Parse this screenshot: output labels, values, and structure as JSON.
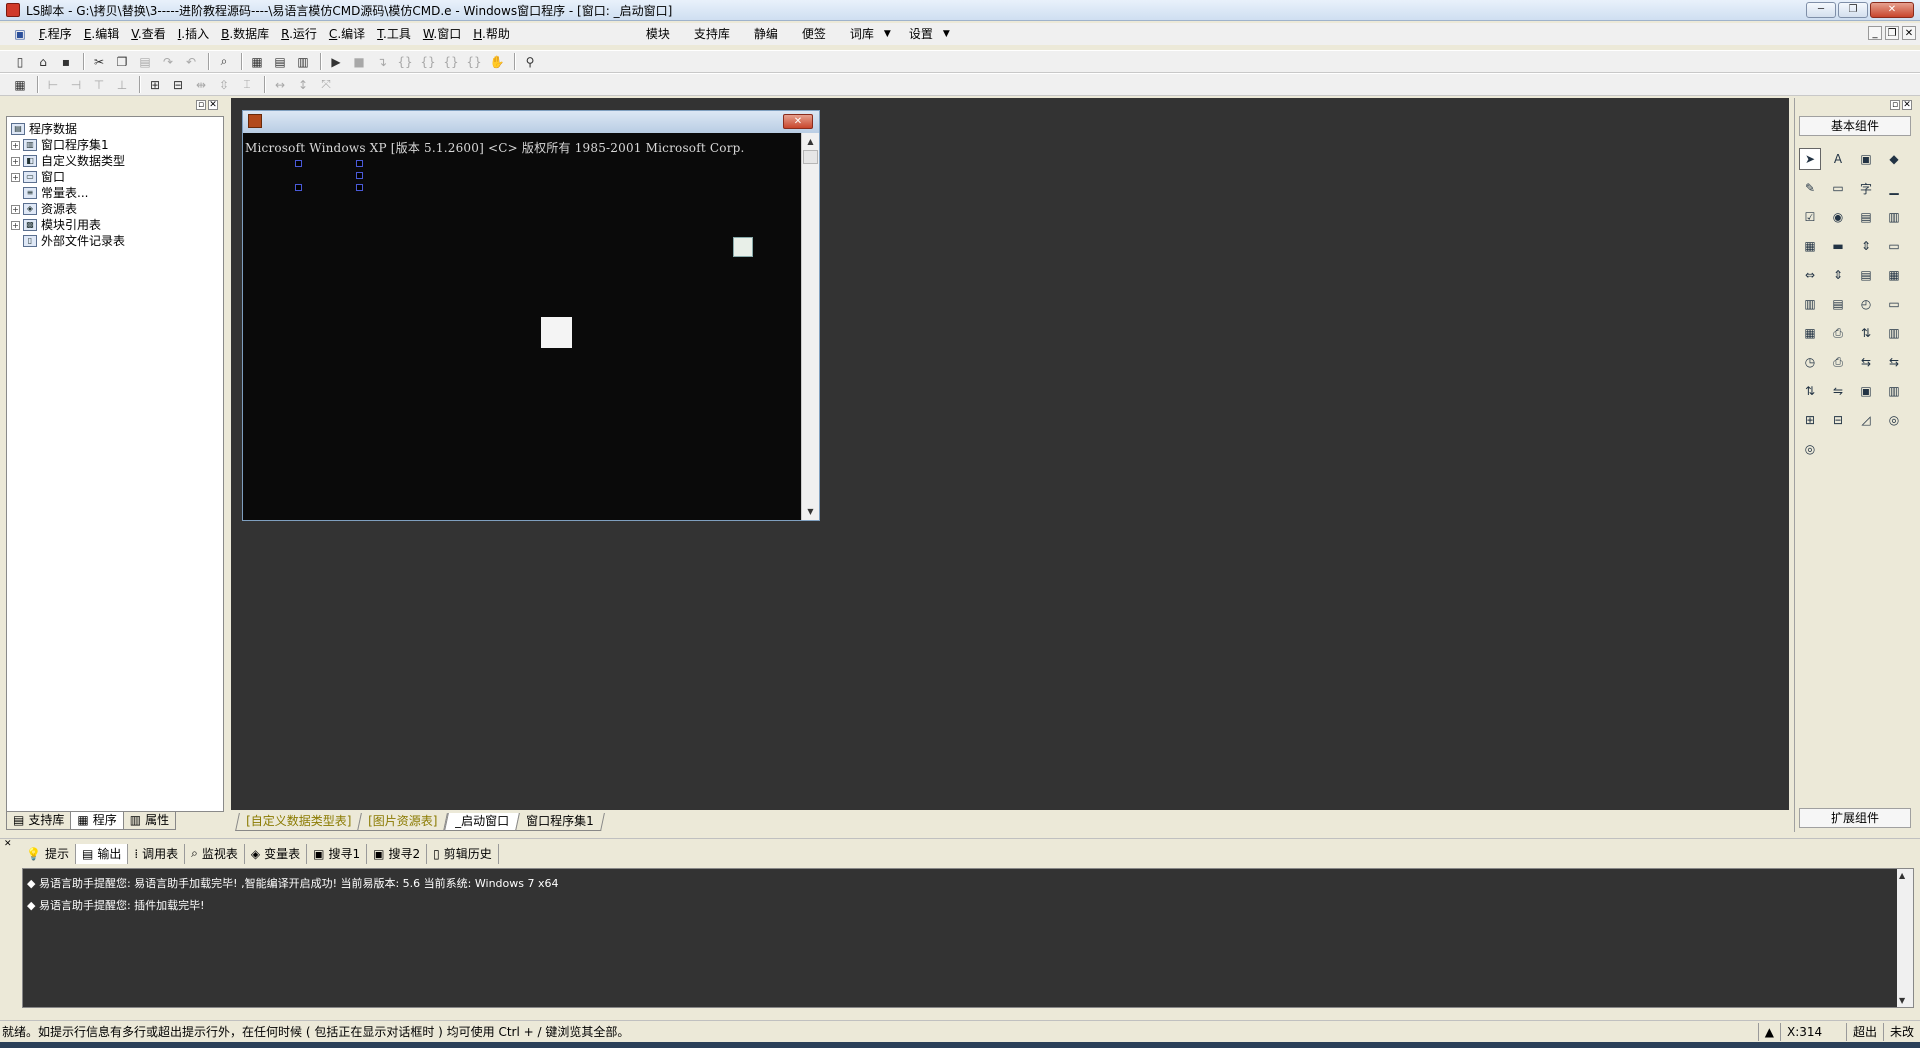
{
  "window": {
    "title": "LS脚本 - G:\\拷贝\\替换\\3-----进阶教程源码----\\易语言模仿CMD源码\\模仿CMD.e - Windows窗口程序 - [窗口: _启动窗口]",
    "buttons": {
      "minimize": "─",
      "restore": "❐",
      "close": "✕"
    }
  },
  "menubar": {
    "items": [
      {
        "key": "F",
        "label": ".程序"
      },
      {
        "key": "E",
        "label": ".编辑"
      },
      {
        "key": "V",
        "label": ".查看"
      },
      {
        "key": "I",
        "label": ".插入"
      },
      {
        "key": "B",
        "label": ".数据库"
      },
      {
        "key": "R",
        "label": ".运行"
      },
      {
        "key": "C",
        "label": ".编译"
      },
      {
        "key": "T",
        "label": ".工具"
      },
      {
        "key": "W",
        "label": ".窗口"
      },
      {
        "key": "H",
        "label": ".帮助"
      }
    ],
    "extras": [
      "模块",
      "支持库",
      "静编",
      "便签",
      "词库",
      "设置"
    ],
    "dropdown_arrow": "▼",
    "doc_buttons": [
      "_",
      "❐",
      "✕"
    ]
  },
  "left_panel": {
    "pin": "▫",
    "close": "✕",
    "tree": [
      {
        "label": "程序数据",
        "expander": "",
        "icon": "db-icon"
      },
      {
        "label": "窗口程序集1",
        "expander": "+",
        "icon": "module-icon"
      },
      {
        "label": "自定义数据类型",
        "expander": "+",
        "icon": "type-icon"
      },
      {
        "label": "窗口",
        "expander": "+",
        "icon": "window-icon"
      },
      {
        "label": "常量表...",
        "expander": "",
        "icon": "const-icon"
      },
      {
        "label": "资源表",
        "expander": "+",
        "icon": "resource-icon"
      },
      {
        "label": "模块引用表",
        "expander": "+",
        "icon": "modref-icon"
      },
      {
        "label": "外部文件记录表",
        "expander": "",
        "icon": "file-icon"
      }
    ],
    "tabs": [
      "支持库",
      "程序",
      "属性"
    ]
  },
  "cmd_window": {
    "close": "✕",
    "text": "Microsoft Windows XP [版本 5.1.2600]  <C> 版权所有 1985-2001 Microsoft Corp.",
    "scroll_up": "▲",
    "scroll_down": "▼"
  },
  "doc_tabs": [
    {
      "label": "[自定义数据类型表]",
      "state": "inactive"
    },
    {
      "label": "[图片资源表]",
      "state": "inactive"
    },
    {
      "label": "_启动窗口",
      "state": "active"
    },
    {
      "label": "窗口程序集1",
      "state": "plain"
    }
  ],
  "right_panel": {
    "pin": "▫",
    "close": "✕",
    "header": "基本组件",
    "footer": "扩展组件",
    "components": [
      "pointer",
      "label",
      "picture",
      "shape",
      "edit",
      "frame",
      "font",
      "line",
      "checkbox",
      "radio",
      "list",
      "tab",
      "grid",
      "slider",
      "spinner",
      "progress",
      "hscroll",
      "vscroll",
      "columns",
      "calendar",
      "table",
      "datebox",
      "clock",
      "filebox",
      "toolbar",
      "printer",
      "splitter",
      "ole",
      "timer",
      "printer2",
      "server",
      "client",
      "port",
      "link",
      "panel",
      "split2",
      "db1",
      "db2",
      "chart",
      "odbc",
      "odbc2"
    ]
  },
  "bottom_tabs": [
    "提示",
    "输出",
    "调用表",
    "监视表",
    "变量表",
    "搜寻1",
    "搜寻2",
    "剪辑历史"
  ],
  "output": {
    "bullet": "◆",
    "lines": [
      "易语言助手提醒您: 易语言助手加载完毕! ,智能编译开启成功! 当前易版本: 5.6 当前系统: Windows 7 x64",
      "易语言助手提醒您: 插件加载完毕!"
    ]
  },
  "statusbar": {
    "text": "就绪。如提示行信息有多行或超出提示行外，在任何时候 ( 包括正在显示对话框时 ) 均可使用 Ctrl + / 键浏览其全部。",
    "coord": "X:314",
    "mode": "超出",
    "state": "未改"
  }
}
